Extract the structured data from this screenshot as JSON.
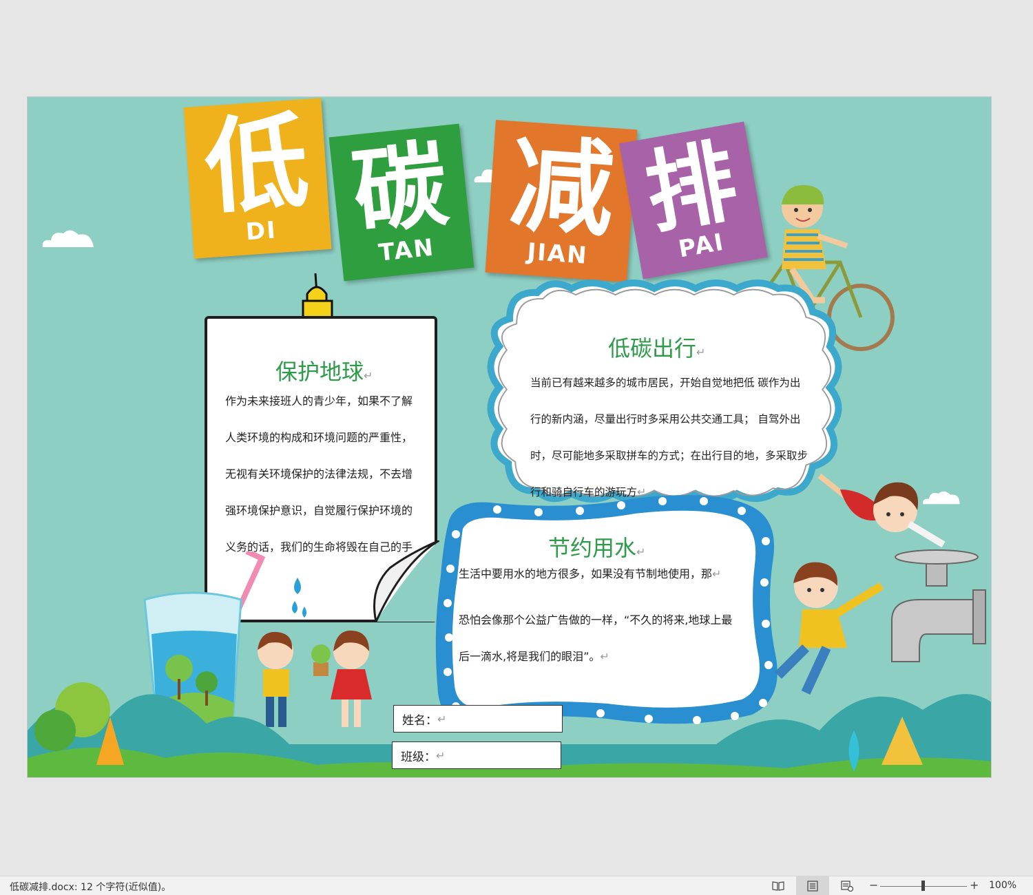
{
  "poster": {
    "title_tiles": [
      {
        "hanzi": "低",
        "pinyin": "DI",
        "color": "#f0b21c"
      },
      {
        "hanzi": "碳",
        "pinyin": "TAN",
        "color": "#2e9e3e"
      },
      {
        "hanzi": "减",
        "pinyin": "JIAN",
        "color": "#e2762a"
      },
      {
        "hanzi": "排",
        "pinyin": "PAI",
        "color": "#a863a8"
      }
    ],
    "protect": {
      "heading": "保护地球",
      "lines": [
        "作为未来接班人的青少年，如果不了解",
        "人类环境的构成和环境问题的严重性，",
        "无视有关环境保护的法律法规，不去增",
        "强环境保护意识，自觉履行保护环境的",
        "义务的话，我们的生命将毁在自己的手"
      ]
    },
    "travel": {
      "heading": "低碳出行",
      "lines": [
        "当前已有越来越多的城市居民，开始自觉地把低  碳作为出",
        "行的新内涵，尽量出行时多采用公共交通工具；  自驾外出",
        "时，尽可能地多采取拼车的方式；在出行目的地，多采取步",
        "行和骑自行车的游玩方"
      ]
    },
    "water": {
      "heading": "节约用水",
      "lines": [
        "生活中要用水的地方很多，如果没有节制地使用，那",
        "恐怕会像那个公益广告做的一样，“不久的将来,地球上最",
        "后一滴水,将是我们的眼泪”。"
      ]
    },
    "name_field": "姓名：",
    "class_field": "班级：",
    "paragraph_mark": "↵"
  },
  "statusbar": {
    "doc_info": "低碳减排.docx: 12 个字符(近似值)。",
    "zoom_minus": "−",
    "zoom_plus": "+",
    "zoom_level": "100%"
  }
}
